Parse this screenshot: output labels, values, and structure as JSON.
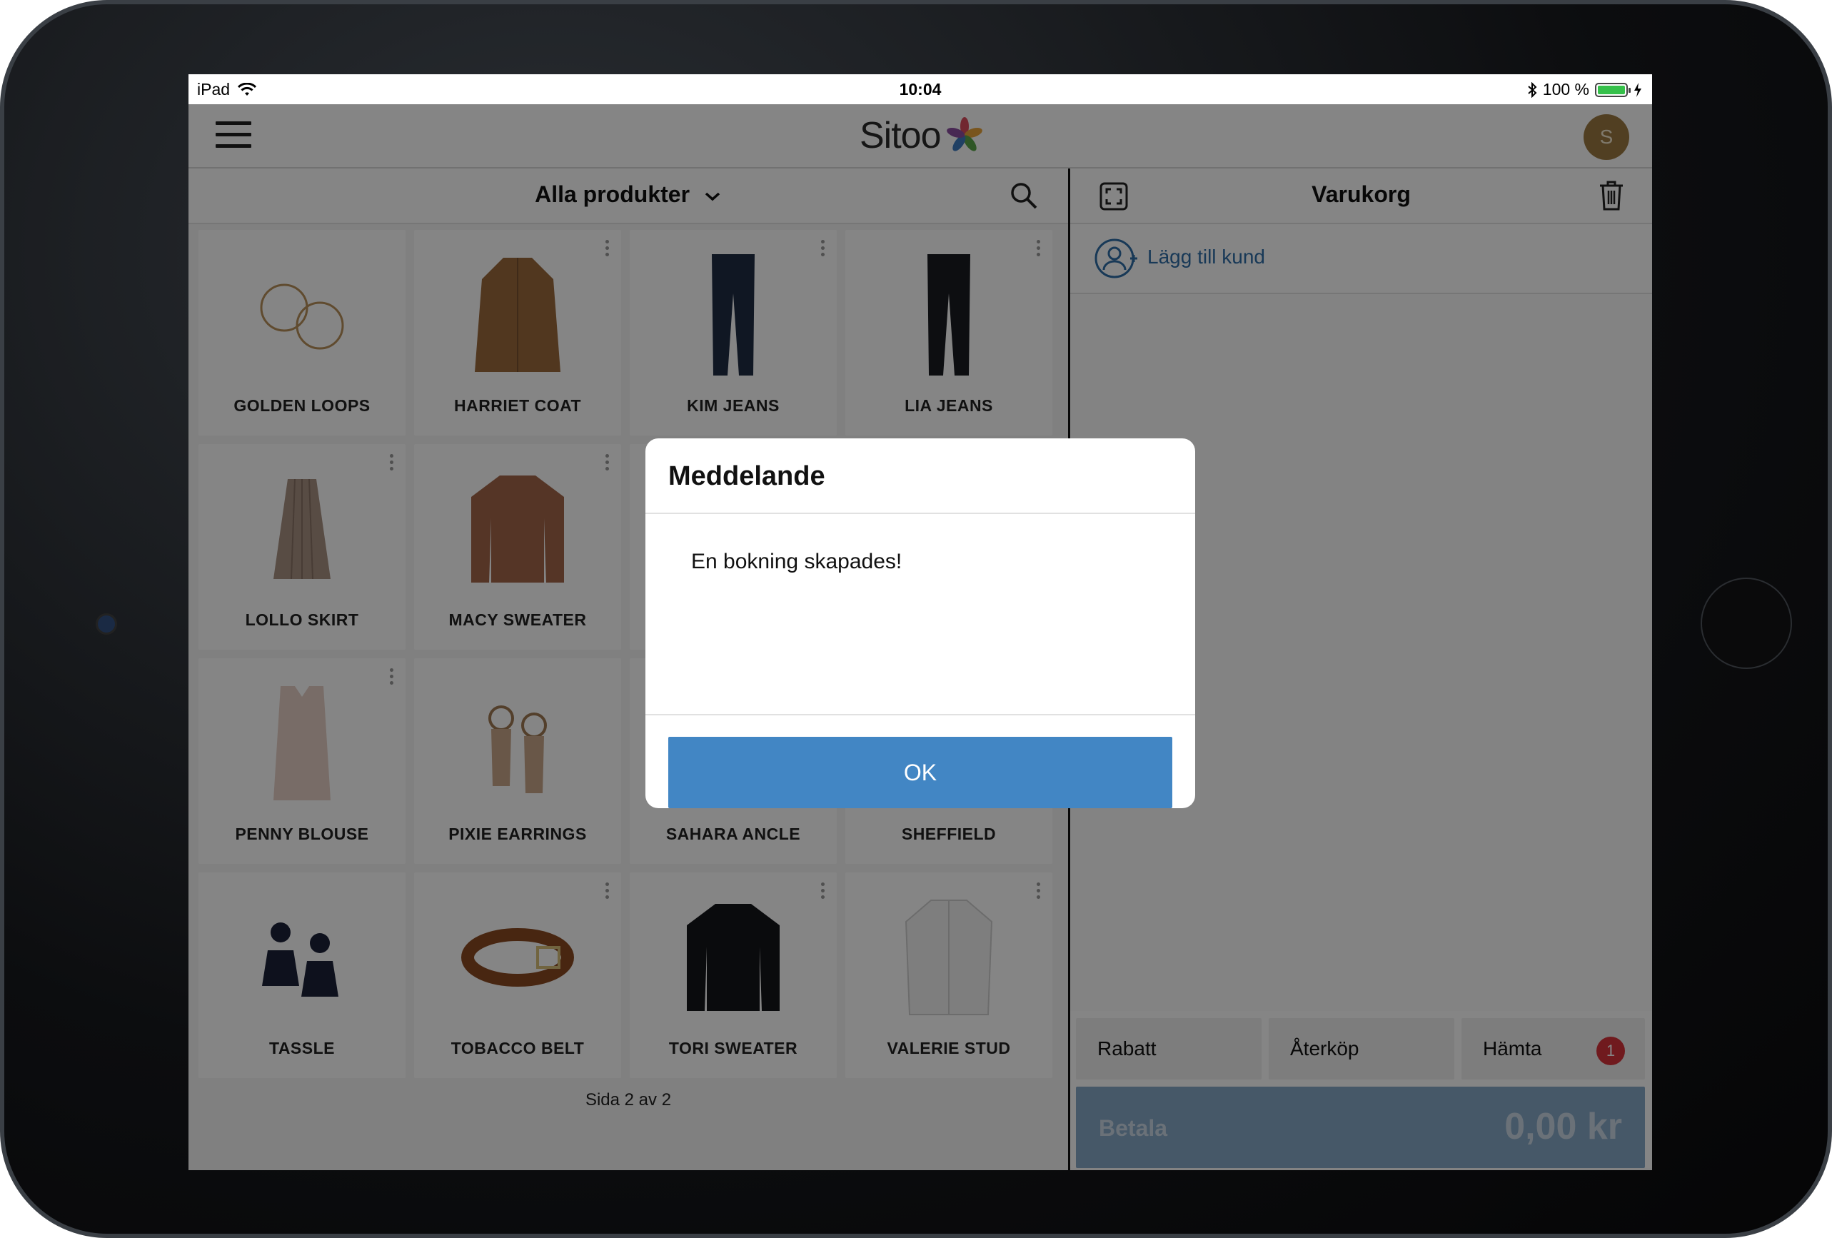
{
  "status_bar": {
    "device": "iPad",
    "time": "10:04",
    "battery": "100 %"
  },
  "app_bar": {
    "logo_text": "Sitoo",
    "avatar_initial": "S"
  },
  "products_panel": {
    "title": "Alla produkter",
    "pager": "Sida 2 av 2",
    "items": [
      {
        "name": "GOLDEN LOOPS"
      },
      {
        "name": "HARRIET COAT"
      },
      {
        "name": "KIM JEANS"
      },
      {
        "name": "LIA JEANS"
      },
      {
        "name": "LOLLO SKIRT"
      },
      {
        "name": "MACY SWEATER"
      },
      {
        "name": ""
      },
      {
        "name": ""
      },
      {
        "name": "PENNY BLOUSE"
      },
      {
        "name": "PIXIE EARRINGS"
      },
      {
        "name": "SAHARA ANCLE"
      },
      {
        "name": "SHEFFIELD"
      },
      {
        "name": "TASSLE"
      },
      {
        "name": "TOBACCO BELT"
      },
      {
        "name": "TORI SWEATER"
      },
      {
        "name": "VALERIE STUD"
      }
    ]
  },
  "cart_panel": {
    "title": "Varukorg",
    "add_customer": "Lägg till kund",
    "actions": {
      "discount": "Rabatt",
      "return": "Återköp",
      "fetch": "Hämta",
      "fetch_badge": "1"
    },
    "pay_label": "Betala",
    "pay_amount": "0,00 kr"
  },
  "dialog": {
    "title": "Meddelande",
    "message": "En bokning skapades!",
    "ok_label": "OK"
  },
  "colors": {
    "accent": "#4286c4",
    "pay_button": "#86a9c8",
    "badge": "#d6333a",
    "link": "#2f6da8"
  }
}
